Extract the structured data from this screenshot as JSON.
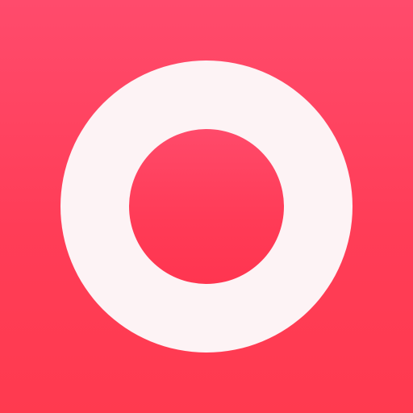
{
  "app_icon": {
    "icon": "record-icon",
    "colors": {
      "background_top": "#ff4b6c",
      "background_bottom": "#ff3a4f",
      "ring": "#fdf3f5",
      "center_dot": "#ff3b56"
    }
  }
}
